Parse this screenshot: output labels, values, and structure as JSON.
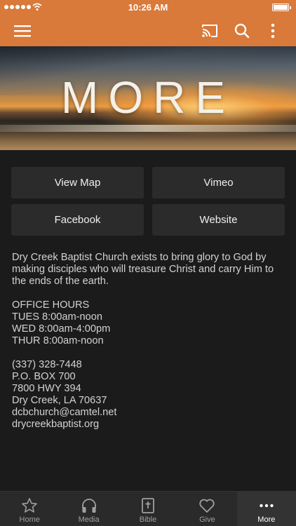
{
  "status_bar": {
    "time": "10:26 AM"
  },
  "toolbar": {
    "icons": [
      "menu-icon",
      "cast-icon",
      "search-icon",
      "more-vertical-icon"
    ]
  },
  "hero": {
    "title": "MORE"
  },
  "buttons": {
    "view_map": "View Map",
    "vimeo": "Vimeo",
    "facebook": "Facebook",
    "website": "Website"
  },
  "info": {
    "mission": "Dry Creek Baptist Church exists to bring glory to God by making disciples who will treasure Christ and carry Him to the ends of the earth.",
    "office_hours_title": "OFFICE HOURS",
    "hours": [
      "TUES 8:00am-noon",
      "WED 8:00am-4:00pm",
      "THUR 8:00am-noon"
    ],
    "contact": {
      "phone": "(337) 328-7448",
      "po_box": "P.O. BOX 700",
      "street": "7800 HWY 394",
      "city": "Dry Creek, LA 70637",
      "email": "dcbchurch@camtel.net",
      "website": "drycreekbaptist.org"
    }
  },
  "tabs": [
    {
      "label": "Home",
      "icon": "star-icon"
    },
    {
      "label": "Media",
      "icon": "headphones-icon"
    },
    {
      "label": "Bible",
      "icon": "bible-icon"
    },
    {
      "label": "Give",
      "icon": "heart-icon"
    },
    {
      "label": "More",
      "icon": "more-horizontal-icon",
      "active": true
    }
  ],
  "colors": {
    "accent": "#d9793a",
    "background": "#1b1b1c",
    "button": "#2b2b2c",
    "tabbar": "#2a2a2b"
  }
}
